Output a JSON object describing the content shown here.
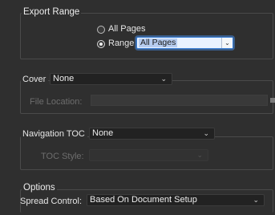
{
  "export_range": {
    "title": "Export Range",
    "options": [
      "All Pages",
      "Range"
    ],
    "selected_option": "Range",
    "range_value": "All Pages"
  },
  "cover": {
    "label": "Cover",
    "value": "None",
    "file_location_label": "File Location:",
    "file_location_value": ""
  },
  "navigation": {
    "toc_label": "Navigation TOC",
    "toc_value": "None",
    "toc_style_label": "TOC Style:",
    "toc_style_value": ""
  },
  "options": {
    "title": "Options",
    "spread_label": "Spread Control:",
    "spread_value": "Based On Document Setup"
  }
}
